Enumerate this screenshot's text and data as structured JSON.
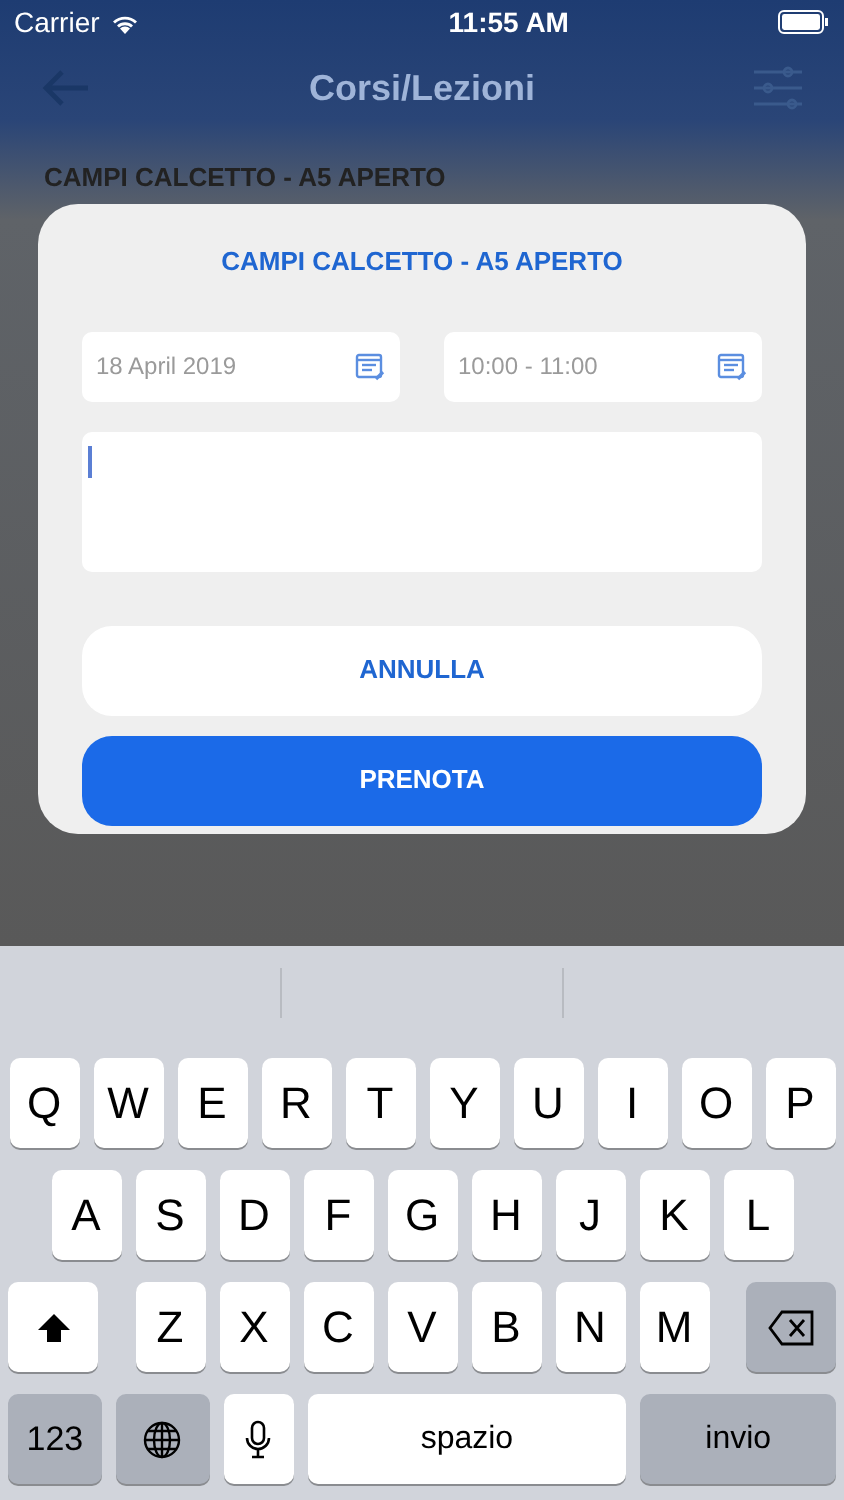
{
  "status_bar": {
    "carrier": "Carrier",
    "time": "11:55 AM"
  },
  "nav": {
    "title": "Corsi/Lezioni"
  },
  "background_title": "CAMPI CALCETTO - A5 APERTO",
  "dialog": {
    "title": "CAMPI CALCETTO - A5 APERTO",
    "date_field": {
      "value": "18 April 2019"
    },
    "time_field": {
      "value": "10:00 - 11:00"
    },
    "buttons": [
      {
        "label": "ANNULLA",
        "kind": "secondary"
      },
      {
        "label": "PRENOTA",
        "kind": "primary"
      }
    ]
  },
  "keyboard": {
    "key_rows": [
      {
        "keys": [
          {
            "kind": "letter",
            "label": "Q"
          },
          {
            "kind": "letter",
            "label": "W"
          },
          {
            "kind": "letter",
            "label": "E"
          },
          {
            "kind": "letter",
            "label": "R"
          },
          {
            "kind": "letter",
            "label": "T"
          },
          {
            "kind": "letter",
            "label": "Y"
          },
          {
            "kind": "letter",
            "label": "U"
          },
          {
            "kind": "letter",
            "label": "I"
          },
          {
            "kind": "letter",
            "label": "O"
          },
          {
            "kind": "letter",
            "label": "P"
          }
        ]
      },
      {
        "keys": [
          {
            "kind": "letter",
            "label": "A"
          },
          {
            "kind": "letter",
            "label": "S"
          },
          {
            "kind": "letter",
            "label": "D"
          },
          {
            "kind": "letter",
            "label": "F"
          },
          {
            "kind": "letter",
            "label": "G"
          },
          {
            "kind": "letter",
            "label": "H"
          },
          {
            "kind": "letter",
            "label": "J"
          },
          {
            "kind": "letter",
            "label": "K"
          },
          {
            "kind": "letter",
            "label": "L"
          }
        ]
      },
      {
        "keys": [
          {
            "kind": "shift"
          },
          {
            "kind": "letter",
            "label": "Z"
          },
          {
            "kind": "letter",
            "label": "X"
          },
          {
            "kind": "letter",
            "label": "C"
          },
          {
            "kind": "letter",
            "label": "V"
          },
          {
            "kind": "letter",
            "label": "B"
          },
          {
            "kind": "letter",
            "label": "N"
          },
          {
            "kind": "letter",
            "label": "M"
          },
          {
            "kind": "delete"
          }
        ]
      },
      {
        "keys": [
          {
            "kind": "numbers",
            "label": "123"
          },
          {
            "kind": "globe"
          },
          {
            "kind": "mic"
          },
          {
            "kind": "space",
            "label": "spazio"
          },
          {
            "kind": "return",
            "label": "invio"
          }
        ]
      }
    ]
  }
}
